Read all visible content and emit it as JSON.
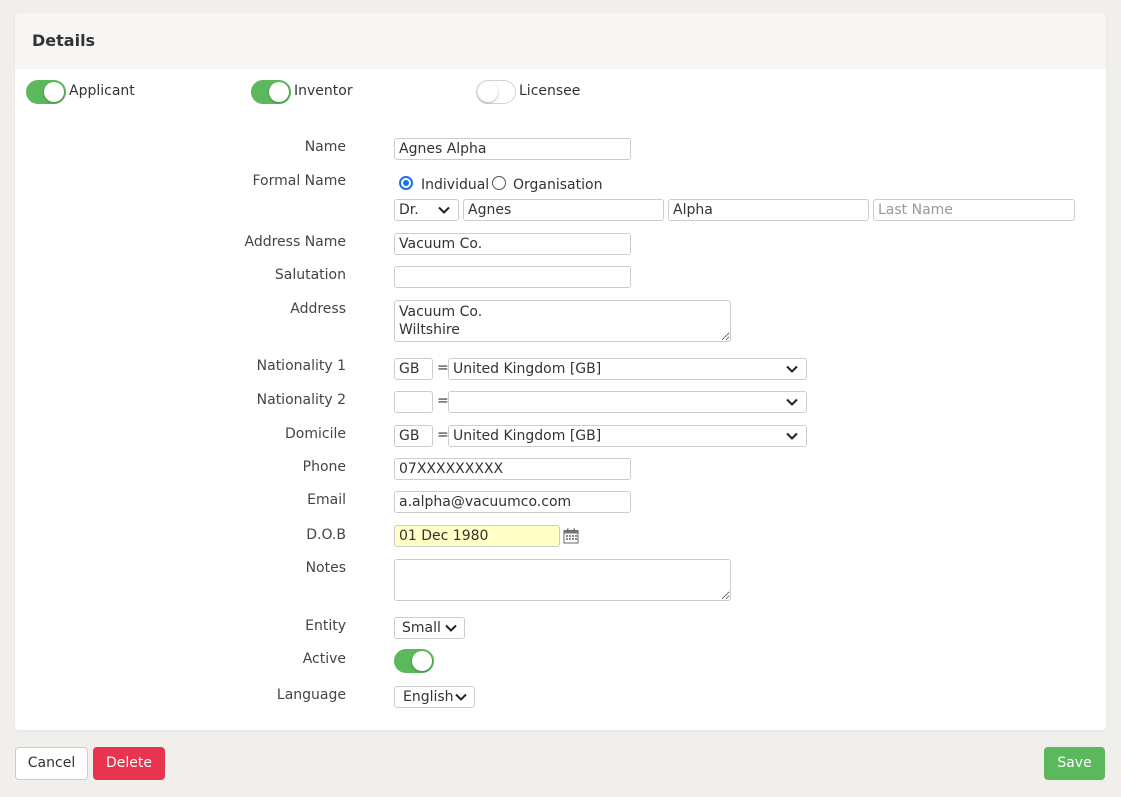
{
  "panel": {
    "title": "Details"
  },
  "roles": [
    {
      "label": "Applicant",
      "on": true
    },
    {
      "label": "Inventor",
      "on": true
    },
    {
      "label": "Licensee",
      "on": false
    }
  ],
  "form": {
    "name": {
      "label": "Name",
      "value": "Agnes Alpha"
    },
    "formal_name": {
      "label": "Formal Name",
      "type_options": [
        "Individual",
        "Organisation"
      ],
      "selected_type": "Individual",
      "title": "Dr.",
      "first_name": "Agnes",
      "middle_name": "Alpha",
      "last_name": "",
      "last_name_placeholder": "Last Name"
    },
    "address_name": {
      "label": "Address Name",
      "value": "Vacuum Co."
    },
    "salutation": {
      "label": "Salutation",
      "value": ""
    },
    "address": {
      "label": "Address",
      "value": "Vacuum Co.\nWiltshire"
    },
    "nationality1": {
      "label": "Nationality 1",
      "code": "GB",
      "country": "United Kingdom [GB]"
    },
    "nationality2": {
      "label": "Nationality 2",
      "code": "",
      "country": ""
    },
    "domicile": {
      "label": "Domicile",
      "code": "GB",
      "country": "United Kingdom [GB]"
    },
    "equals": "=",
    "phone": {
      "label": "Phone",
      "value": "07XXXXXXXXX"
    },
    "email": {
      "label": "Email",
      "value": "a.alpha@vacuumco.com"
    },
    "dob": {
      "label": "D.O.B",
      "value": "01 Dec 1980",
      "highlight_color": "#ffffc6"
    },
    "notes": {
      "label": "Notes",
      "value": ""
    },
    "entity": {
      "label": "Entity",
      "value": "Small"
    },
    "active": {
      "label": "Active",
      "on": true
    },
    "language": {
      "label": "Language",
      "value": "English"
    }
  },
  "footer": {
    "cancel": "Cancel",
    "delete": "Delete",
    "save": "Save"
  },
  "colors": {
    "toggle_on": "#5cb85c",
    "delete": "#e8344e",
    "save": "#5cb85c",
    "radio_checked": "#1a73e8"
  },
  "icons": [
    "chevron-down-icon",
    "calendar-icon"
  ]
}
